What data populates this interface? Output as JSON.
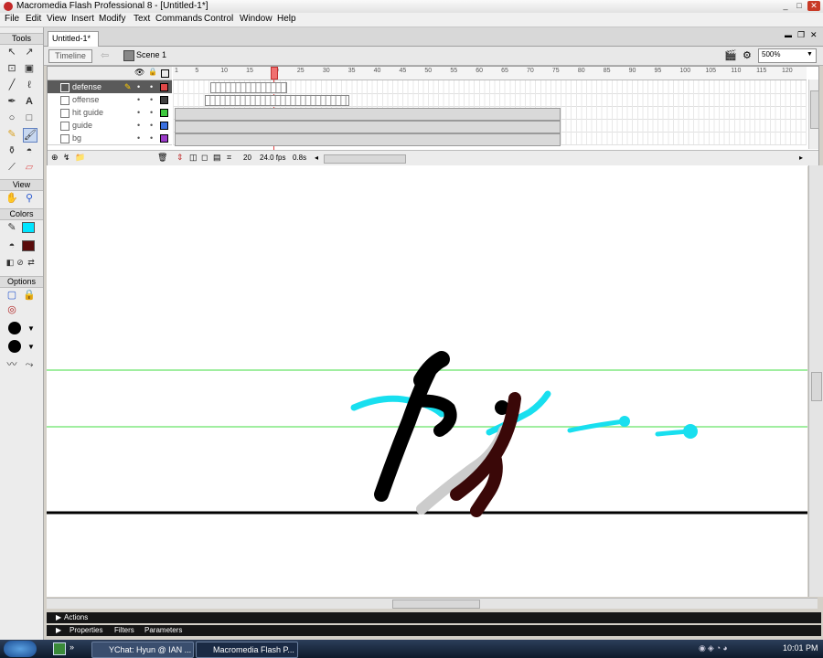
{
  "window": {
    "title": "Macromedia Flash Professional 8 - [Untitled-1*]",
    "min": "_",
    "max": "□",
    "close": "✕"
  },
  "menubar": {
    "items": [
      "File",
      "Edit",
      "View",
      "Insert",
      "Modify",
      "Text",
      "Commands",
      "Control",
      "Window",
      "Help"
    ]
  },
  "tools": {
    "title": "Tools",
    "view_label": "View",
    "colors_label": "Colors",
    "options_label": "Options"
  },
  "document": {
    "tab": "Untitled-1*",
    "min": "▬",
    "restore": "❐",
    "close": "✕"
  },
  "scenebar": {
    "timeline_button": "Timeline",
    "scene": "Scene 1",
    "zoom": "500%"
  },
  "timeline": {
    "frame_numbers": [
      "1",
      "5",
      "10",
      "15",
      "20",
      "25",
      "30",
      "35",
      "40",
      "45",
      "50",
      "55",
      "60",
      "65",
      "70",
      "75",
      "80",
      "85",
      "90",
      "95",
      "100",
      "105",
      "110",
      "115",
      "120"
    ],
    "layers": [
      {
        "name": "defense",
        "color": "#e04848",
        "selected": true
      },
      {
        "name": "offense",
        "color": "#404040",
        "selected": false
      },
      {
        "name": "hit guide",
        "color": "#3ec83e",
        "selected": false
      },
      {
        "name": "guide",
        "color": "#3a70e0",
        "selected": false
      },
      {
        "name": "bg",
        "color": "#9a3ac8",
        "selected": false
      }
    ],
    "current_frame": "20",
    "fps": "24.0 fps",
    "elapsed": "0.8s"
  },
  "panels": {
    "actions": "Actions",
    "properties": "Properties",
    "filters": "Filters",
    "parameters": "Parameters"
  },
  "taskbar": {
    "tasks": [
      "YChat: Hyun @ IAN ...",
      "Macromedia Flash P..."
    ],
    "clock": "10:01 PM"
  },
  "colors": {
    "stroke": "#00e5ff",
    "fill": "#5a0c0c",
    "accent": "#e04848"
  }
}
